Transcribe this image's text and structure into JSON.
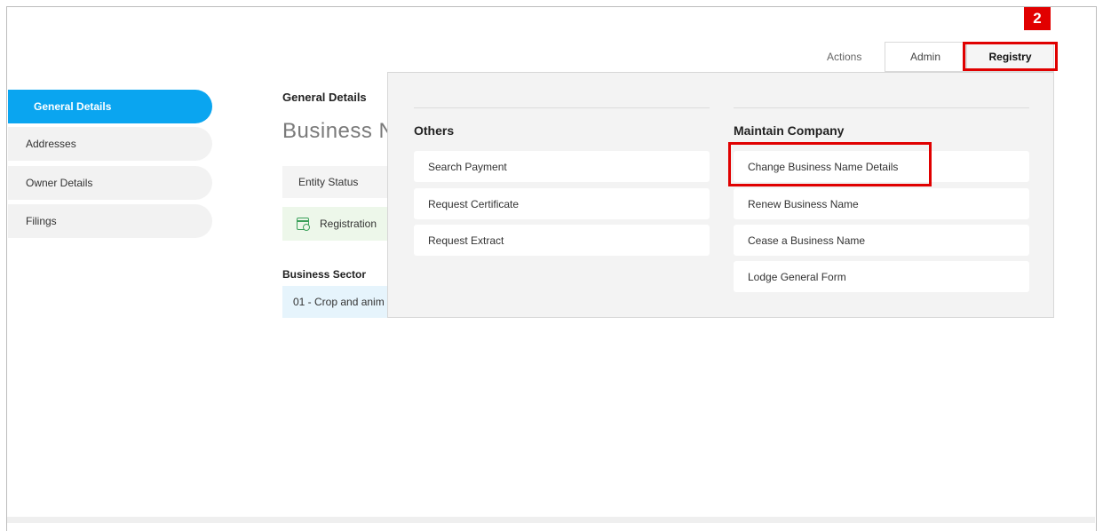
{
  "header": {
    "actions_label": "Actions",
    "tabs": [
      {
        "label": "Admin"
      },
      {
        "label": "Registry"
      }
    ],
    "step_badge": "2"
  },
  "sidebar": {
    "items": [
      {
        "label": "General Details",
        "active": true
      },
      {
        "label": "Addresses"
      },
      {
        "label": "Owner Details"
      },
      {
        "label": "Filings"
      }
    ]
  },
  "main": {
    "section_heading": "General Details",
    "title": "Business N",
    "entity_status_label": "Entity Status",
    "registration_label": "Registration",
    "business_sector_heading": "Business Sector",
    "business_sector_value": "01 - Crop and anim"
  },
  "dropdown": {
    "others": {
      "heading": "Others",
      "items": [
        "Search Payment",
        "Request Certificate",
        "Request Extract"
      ]
    },
    "maintain_company": {
      "heading": "Maintain Company",
      "items": [
        "Change Business Name Details",
        "Renew Business Name",
        "Cease a Business Name",
        "Lodge General Form"
      ]
    }
  },
  "colors": {
    "accent": "#0aa5f0",
    "highlight": "#e00000"
  },
  "icons": {
    "registration": "calendar-icon"
  }
}
